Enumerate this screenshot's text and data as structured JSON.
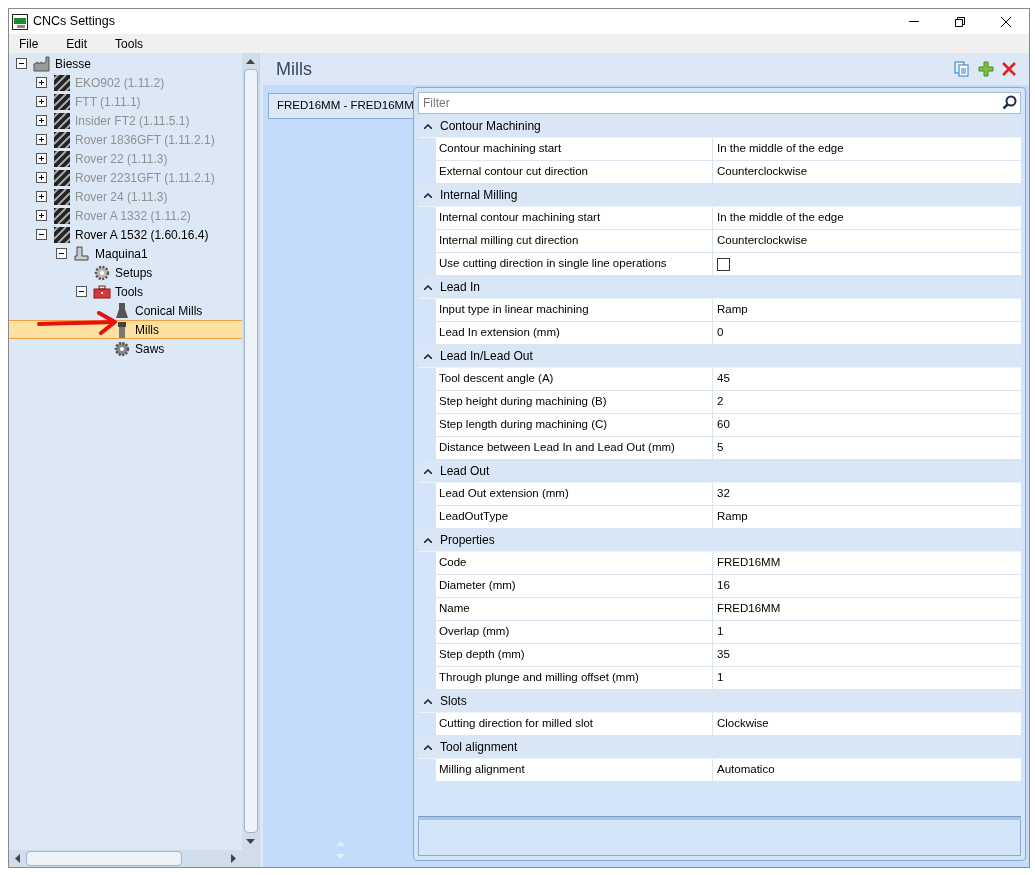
{
  "window": {
    "title": "CNCs Settings"
  },
  "menu": [
    "File",
    "Edit",
    "Tools"
  ],
  "tree": [
    {
      "label": "Biesse",
      "kind": "factory",
      "expanded": true,
      "disabled": false,
      "selected": false,
      "children": [
        {
          "label": "EKO902 (1.11.2)",
          "kind": "cnc",
          "expanded": false,
          "disabled": true,
          "selected": false
        },
        {
          "label": "FTT (1.11.1)",
          "kind": "cnc",
          "expanded": false,
          "disabled": true,
          "selected": false
        },
        {
          "label": "Insider FT2 (1.11.5.1)",
          "kind": "cnc",
          "expanded": false,
          "disabled": true,
          "selected": false
        },
        {
          "label": "Rover 1836GFT (1.11.2.1)",
          "kind": "cnc",
          "expanded": false,
          "disabled": true,
          "selected": false
        },
        {
          "label": "Rover 22 (1.11.3)",
          "kind": "cnc",
          "expanded": false,
          "disabled": true,
          "selected": false
        },
        {
          "label": "Rover 2231GFT (1.11.2.1)",
          "kind": "cnc",
          "expanded": false,
          "disabled": true,
          "selected": false
        },
        {
          "label": "Rover 24 (1.11.3)",
          "kind": "cnc",
          "expanded": false,
          "disabled": true,
          "selected": false
        },
        {
          "label": "Rover A 1332 (1.11.2)",
          "kind": "cnc",
          "expanded": false,
          "disabled": true,
          "selected": false
        },
        {
          "label": "Rover A 1532 (1.60.16.4)",
          "kind": "cnc",
          "expanded": true,
          "disabled": false,
          "selected": false,
          "children": [
            {
              "label": "Maquina1",
              "kind": "machine",
              "expanded": true,
              "disabled": false,
              "selected": false,
              "children": [
                {
                  "label": "Setups",
                  "kind": "gear",
                  "disabled": false,
                  "selected": false
                },
                {
                  "label": "Tools",
                  "kind": "toolbox",
                  "expanded": true,
                  "disabled": false,
                  "selected": false,
                  "children": [
                    {
                      "label": "Conical Mills",
                      "kind": "conical",
                      "disabled": false,
                      "selected": false
                    },
                    {
                      "label": "Mills",
                      "kind": "mill",
                      "disabled": false,
                      "selected": true
                    },
                    {
                      "label": "Saws",
                      "kind": "saw",
                      "disabled": false,
                      "selected": false
                    }
                  ]
                }
              ]
            }
          ]
        }
      ]
    }
  ],
  "page": {
    "title": "Mills",
    "tabs": [
      {
        "label": "FRED16MM - FRED16MM",
        "selected": true
      }
    ],
    "filter": {
      "placeholder": "Filter"
    },
    "groups": [
      {
        "title": "Contour Machining",
        "expanded": true,
        "rows": [
          {
            "name": "Contour machining start",
            "value": "In the middle of the edge"
          },
          {
            "name": "External contour cut direction",
            "value": "Counterclockwise"
          }
        ]
      },
      {
        "title": "Internal Milling",
        "expanded": true,
        "rows": [
          {
            "name": "Internal contour machining start",
            "value": "In the middle of the edge"
          },
          {
            "name": "Internal milling cut direction",
            "value": "Counterclockwise"
          },
          {
            "name": "Use cutting direction in single line operations",
            "kind": "checkbox",
            "checked": false
          }
        ]
      },
      {
        "title": "Lead In",
        "expanded": true,
        "rows": [
          {
            "name": "Input type in linear machining",
            "value": "Ramp"
          },
          {
            "name": "Lead In extension (mm)",
            "value": "0"
          }
        ]
      },
      {
        "title": "Lead In/Lead Out",
        "expanded": true,
        "rows": [
          {
            "name": "Tool descent angle (A)",
            "value": "45"
          },
          {
            "name": "Step height during machining (B)",
            "value": "2"
          },
          {
            "name": "Step length during machining (C)",
            "value": "60"
          },
          {
            "name": "Distance between Lead In and Lead Out (mm)",
            "value": "5"
          }
        ]
      },
      {
        "title": "Lead Out",
        "expanded": true,
        "rows": [
          {
            "name": "Lead Out extension (mm)",
            "value": "32"
          },
          {
            "name": "LeadOutType",
            "value": "Ramp"
          }
        ]
      },
      {
        "title": "Properties",
        "expanded": true,
        "rows": [
          {
            "name": "Code",
            "value": "FRED16MM"
          },
          {
            "name": "Diameter (mm)",
            "value": "16"
          },
          {
            "name": "Name",
            "value": "FRED16MM"
          },
          {
            "name": "Overlap (mm)",
            "value": "1"
          },
          {
            "name": "Step depth (mm)",
            "value": "35"
          },
          {
            "name": "Through plunge and milling offset (mm)",
            "value": "1"
          }
        ]
      },
      {
        "title": "Slots",
        "expanded": true,
        "rows": [
          {
            "name": "Cutting direction for milled slot",
            "value": "Clockwise"
          }
        ]
      },
      {
        "title": "Tool alignment",
        "expanded": true,
        "rows": [
          {
            "name": "Milling alignment",
            "value": "Automatico"
          }
        ]
      }
    ]
  }
}
